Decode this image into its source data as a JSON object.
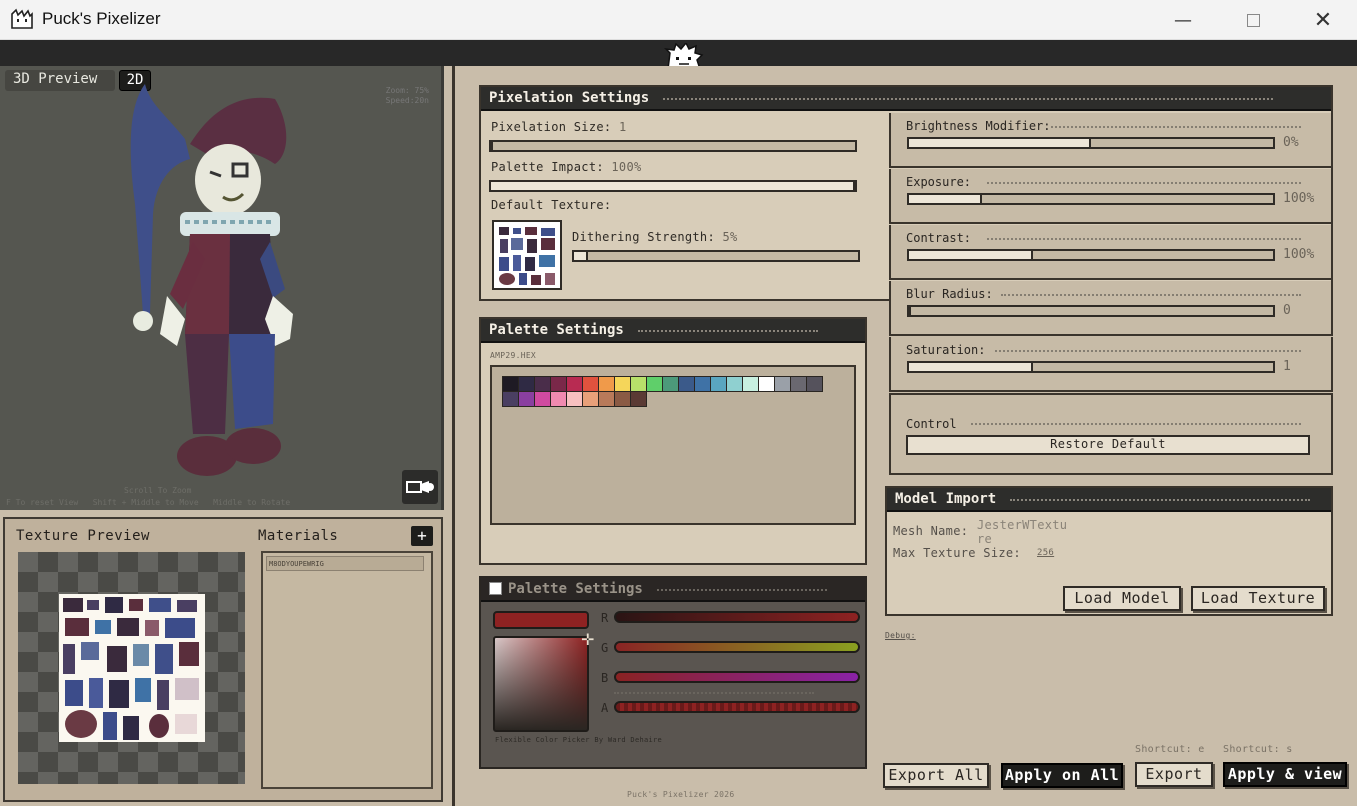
{
  "window": {
    "title": "Puck's Pixelizer",
    "minimize": "—",
    "close": "✕"
  },
  "preview": {
    "tab_3d": "3D Preview",
    "tab_2d": "2D",
    "zoom": "Zoom: 75%",
    "speed": "Speed:20n",
    "hint_zoom": "Scroll To Zoom",
    "hint_controls": "F To reset View   Shift + Middle to Move   Middle to Rotate"
  },
  "texture_panel": {
    "title": "Texture Preview",
    "materials_title": "Materials",
    "add": "+",
    "materials": [
      "M8ODYOUPEWRIG"
    ]
  },
  "pixelation": {
    "title": "Pixelation Settings",
    "size_label": "Pixelation Size:",
    "size_value": "1",
    "impact_label": "Palette Impact:",
    "impact_value": "100%",
    "default_texture_label": "Default Texture:",
    "dither_label": "Dithering Strength:",
    "dither_value": "5%",
    "size_level": 0.0,
    "impact_level": 1.0,
    "dither_level": 0.05
  },
  "adjustments": [
    {
      "label": "Brightness Modifier:",
      "value": "0%",
      "level": 0.5
    },
    {
      "label": "Exposure:",
      "value": "100%",
      "level": 0.2
    },
    {
      "label": "Contrast:",
      "value": "100%",
      "level": 0.34
    },
    {
      "label": "Blur Radius:",
      "value": "0",
      "level": 0.0
    },
    {
      "label": "Saturation:",
      "value": "1",
      "level": 0.34
    }
  ],
  "control": {
    "label": "Control",
    "restore": "Restore Default"
  },
  "palette": {
    "title": "Palette Settings",
    "file": "AMP29.HEX",
    "colors": [
      "#1e1a24",
      "#2f2a44",
      "#4a2d4a",
      "#7a2849",
      "#b82b52",
      "#e0523e",
      "#f09a4a",
      "#f5d65a",
      "#b8e06a",
      "#5fcf6a",
      "#4c9a7a",
      "#3b5a8a",
      "#3f72a6",
      "#5aa6c0",
      "#8fd0d0",
      "#c8f0e0",
      "#ffffff",
      "#9aa0a8",
      "#6a6870",
      "#55525c",
      "#4a3f62",
      "#8a3fa0",
      "#d04aa0",
      "#f08ab0",
      "#f8c0c0",
      "#e8a07a",
      "#b87a5a",
      "#8a5a44",
      "#5a3a34"
    ]
  },
  "color_picker": {
    "title": "Palette Settings",
    "r": "R",
    "g": "G",
    "b": "B",
    "a": "A",
    "credit": "Flexible Color Picker By Ward Dehaire",
    "selected_color": "#8e2222"
  },
  "model_import": {
    "title": "Model Import",
    "mesh_label": "Mesh Name:",
    "mesh_value": "JesterWTexture",
    "max_label": "Max Texture Size:",
    "max_value": "256",
    "load_model": "Load Model",
    "load_texture": "Load Texture"
  },
  "debug": "Debug:",
  "footer": {
    "export_all": "Export All",
    "apply_all": "Apply on All",
    "export": "Export",
    "apply_view": "Apply & view",
    "shortcut_export": "Shortcut: e",
    "shortcut_apply": "Shortcut: s",
    "copyright": "Puck's Pixelizer 2026"
  }
}
